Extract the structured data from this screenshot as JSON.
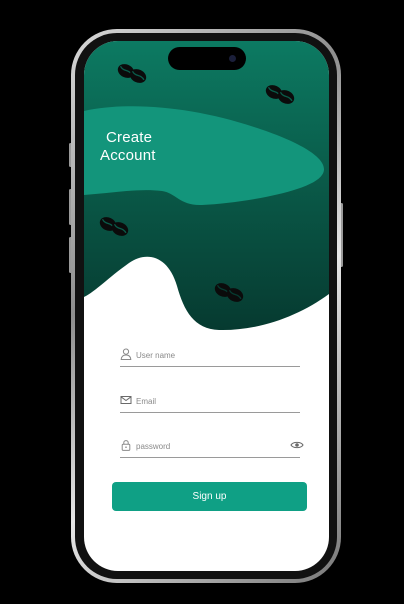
{
  "header": {
    "title_line1": "Create",
    "title_line2": "Account"
  },
  "form": {
    "username": {
      "placeholder": "User name",
      "icon": "user-icon"
    },
    "email": {
      "placeholder": "Email",
      "icon": "mail-icon"
    },
    "password": {
      "placeholder": "password",
      "icon": "lock-icon",
      "toggle_icon": "eye-icon"
    }
  },
  "actions": {
    "signup_label": "Sign up"
  },
  "colors": {
    "accent": "#0fa085",
    "hero_dark": "#0a5a47",
    "hero_light": "#14977d"
  },
  "decorations": {
    "icon": "coffee-beans-icon"
  }
}
